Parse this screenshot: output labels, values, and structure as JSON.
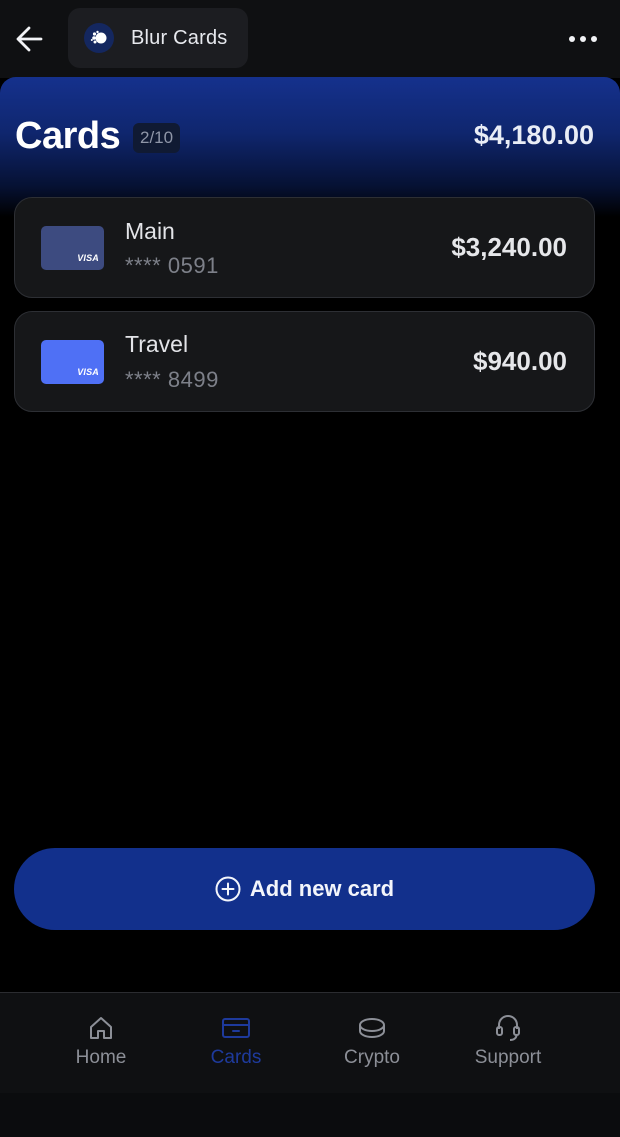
{
  "header": {
    "back_icon": "arrow-left-icon",
    "app_logo_icon": "blur-logo-icon",
    "app_title": "Blur Cards",
    "more_icon": "more-horizontal-icon"
  },
  "hero": {
    "title": "Cards",
    "count_badge": "2/10",
    "total_balance": "$4,180.00",
    "gradient_color": "#15318d"
  },
  "cards": [
    {
      "name": "Main",
      "number": "**** 0591",
      "balance": "$3,240.00",
      "brand": "VISA",
      "color": "#3d4b80"
    },
    {
      "name": "Travel",
      "number": "**** 8499",
      "balance": "$940.00",
      "brand": "VISA",
      "color": "#4f70f5"
    }
  ],
  "add_card": {
    "label": "Add new card",
    "icon": "plus-circle-icon",
    "color": "#12308c"
  },
  "tabs": [
    {
      "label": "Home",
      "icon": "home-icon",
      "active": false
    },
    {
      "label": "Cards",
      "icon": "credit-card-icon",
      "active": true
    },
    {
      "label": "Crypto",
      "icon": "coin-icon",
      "active": false
    },
    {
      "label": "Support",
      "icon": "headset-icon",
      "active": false
    }
  ],
  "colors": {
    "background": "#000000",
    "accent": "#12308c",
    "active_tab": "#1e3a9c",
    "inactive_tab": "#8c8f97"
  }
}
